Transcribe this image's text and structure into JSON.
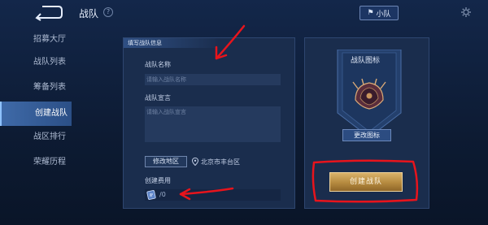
{
  "header": {
    "title": "战队",
    "help_icon": "question-circle-icon",
    "team_button_label": "小队"
  },
  "sidebar": {
    "items": [
      {
        "label": "招募大厅",
        "active": false
      },
      {
        "label": "战队列表",
        "active": false
      },
      {
        "label": "筹备列表",
        "active": false
      },
      {
        "label": "创建战队",
        "active": true
      },
      {
        "label": "战区排行",
        "active": false
      },
      {
        "label": "荣耀历程",
        "active": false
      }
    ]
  },
  "form": {
    "section_title": "填写战队信息",
    "name_label": "战队名称",
    "name_placeholder": "请输入战队名称",
    "declaration_label": "战队宣言",
    "declaration_placeholder": "请输入战队宣言",
    "region_button": "修改地区",
    "location": "北京市丰台区",
    "cost_label": "创建费用",
    "cost_value": "/0"
  },
  "emblem": {
    "title": "战队图标",
    "change_button": "更改图标",
    "create_button": "创建战队"
  },
  "colors": {
    "annotation": "#e8141c",
    "accent": "#8ec2ff",
    "gold": "#d9b26a"
  }
}
